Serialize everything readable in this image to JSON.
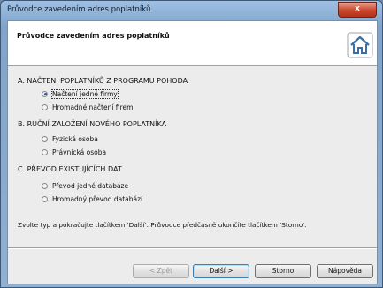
{
  "window": {
    "title": "Průvodce zavedením adres poplatníků",
    "close_label": "x"
  },
  "header": {
    "title": "Průvodce zavedením adres poplatníků",
    "icon": "home-icon"
  },
  "sections": [
    {
      "title": "A. NAČTENÍ POPLATNÍKŮ Z PROGRAMU POHODA",
      "options": [
        {
          "label": "Načtení jedné firmy",
          "checked": true,
          "focused": true
        },
        {
          "label": "Hromadné načtení firem",
          "checked": false
        }
      ]
    },
    {
      "title": "B. RUČNÍ ZALOŽENÍ NOVÉHO POPLATNÍKA",
      "options": [
        {
          "label": "Fyzická osoba",
          "checked": false
        },
        {
          "label": "Právnická osoba",
          "checked": false
        }
      ]
    },
    {
      "title": "C. PŘEVOD EXISTUJÍCÍCH DAT",
      "options": [
        {
          "label": "Převod jedné databáze",
          "checked": false
        },
        {
          "label": "Hromadný převod databází",
          "checked": false
        }
      ]
    }
  ],
  "hint": "Zvolte typ a pokračujte tlačítkem 'Další'. Průvodce předčasně ukončíte tlačítkem 'Storno'.",
  "buttons": {
    "back": "< Zpět",
    "next": "Další >",
    "cancel": "Storno",
    "help": "Nápověda"
  },
  "colors": {
    "accent": "#2a55a5",
    "icon_blue": "#3a6ea5"
  }
}
